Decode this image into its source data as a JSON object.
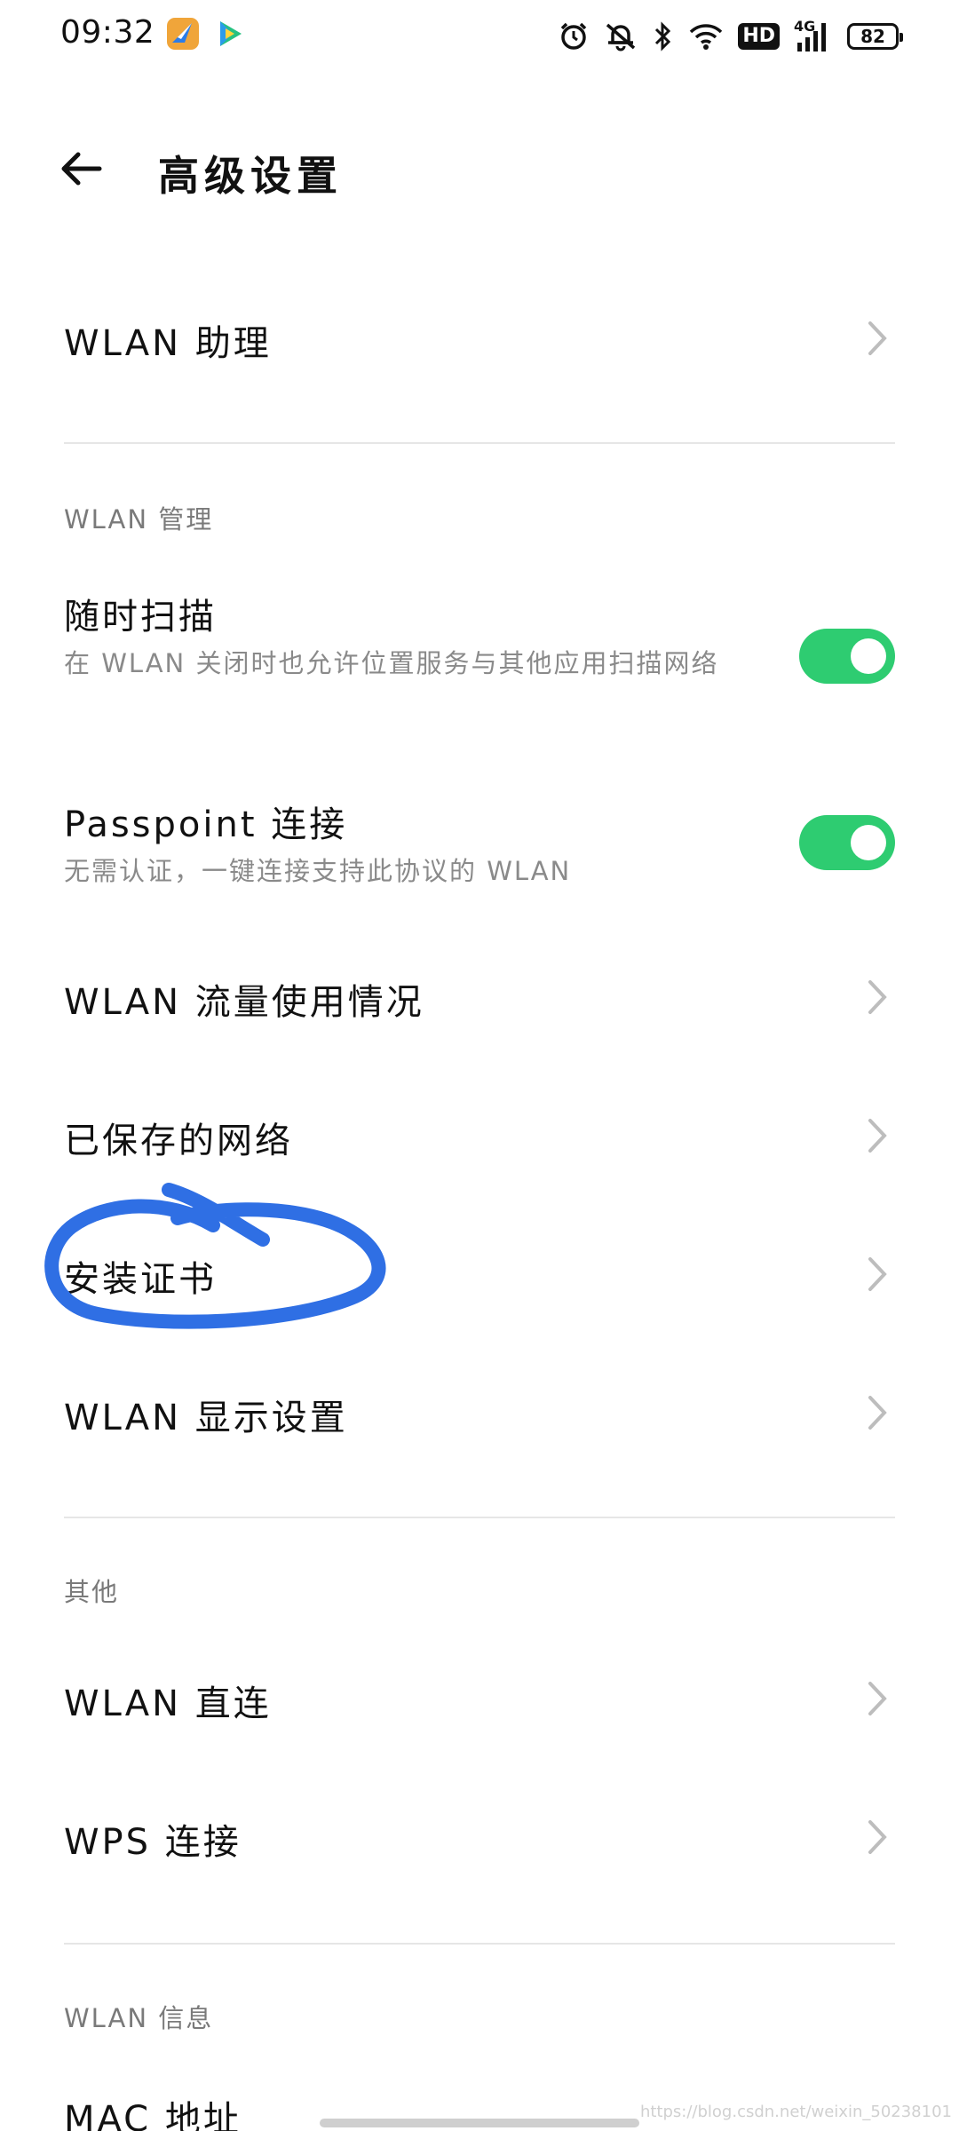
{
  "status_bar": {
    "time": "09:32",
    "battery": "82",
    "hd": "HD",
    "network": "4G"
  },
  "header": {
    "title": "高级设置"
  },
  "items": {
    "wlan_assistant": "WLAN 助理",
    "scan_anytime_title": "随时扫描",
    "scan_anytime_subtitle": "在 WLAN 关闭时也允许位置服务与其他应用扫描网络",
    "passpoint_title": "Passpoint 连接",
    "passpoint_subtitle": "无需认证，一键连接支持此协议的 WLAN",
    "wlan_traffic": "WLAN 流量使用情况",
    "saved_networks": "已保存的网络",
    "install_cert": "安装证书",
    "wlan_display": "WLAN 显示设置",
    "wlan_direct": "WLAN 直连",
    "wps": "WPS 连接",
    "mac_address": "MAC 地址"
  },
  "sections": {
    "wlan_manage": "WLAN 管理",
    "other": "其他",
    "wlan_info": "WLAN 信息"
  },
  "toggles": {
    "scan_anytime": true,
    "passpoint": true
  },
  "colors": {
    "toggle_on": "#2ecc71",
    "highlight": "#2f6fe4"
  },
  "watermark": "https://blog.csdn.net/weixin_50238101"
}
